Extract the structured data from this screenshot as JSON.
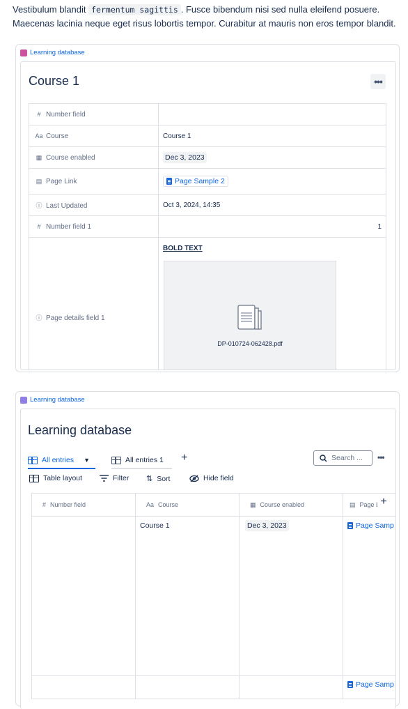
{
  "intro": {
    "text_a": "Vestibulum blandit ",
    "code": "fermentum sagittis",
    "text_b": ". Fusce bibendum nisi sed nulla eleifend posuere. Maecenas lacinia neque eget risus lobortis tempor. Curabitur at mauris non eros tempor blandit."
  },
  "card1": {
    "db_label": "Learning database",
    "title": "Course 1",
    "more": "•••",
    "rows": [
      {
        "icon": "#",
        "name": "Number field",
        "value": ""
      },
      {
        "icon": "Aa",
        "name": "Course",
        "value": "Course 1"
      },
      {
        "icon": "▦",
        "name": "Course enabled",
        "value": "Dec 3, 2023"
      },
      {
        "icon": "▤",
        "name": "Page Link",
        "value": "Page Sample 2"
      },
      {
        "icon": "ⓘ",
        "name": "Last Updated",
        "value": "Oct 3, 2024, 14:35"
      },
      {
        "icon": "#",
        "name": "Number field 1",
        "value": "1"
      },
      {
        "icon": "ⓘ",
        "name": "Page details field 1",
        "value": "BOLD TEXT",
        "file": "DP-010724-062428.pdf"
      }
    ]
  },
  "card2": {
    "db_label": "Learning database",
    "title": "Learning database",
    "tabs": {
      "all_entries": "All entries",
      "all_entries_1": "All entries 1",
      "add": "+"
    },
    "search_placeholder": "Search ...",
    "more": "•••",
    "toolbar": {
      "layout": "Table layout",
      "filter": "Filter",
      "sort": "Sort",
      "hide": "Hide field"
    },
    "columns": [
      {
        "icon": "#",
        "name": "Number field"
      },
      {
        "icon": "Aa",
        "name": "Course"
      },
      {
        "icon": "▦",
        "name": "Course enabled"
      },
      {
        "icon": "▤",
        "name": "Page Li"
      }
    ],
    "add_column": "+",
    "row": {
      "number": "",
      "course": "Course 1",
      "enabled": "Dec 3, 2023",
      "link": "Page Samp"
    },
    "footer_link": "Page Samp"
  },
  "colors": {
    "link": "#0c66e4",
    "border": "#dcdfe4",
    "db_icon_pink": "#cd519d",
    "db_icon_purple": "#8f7ee7"
  }
}
